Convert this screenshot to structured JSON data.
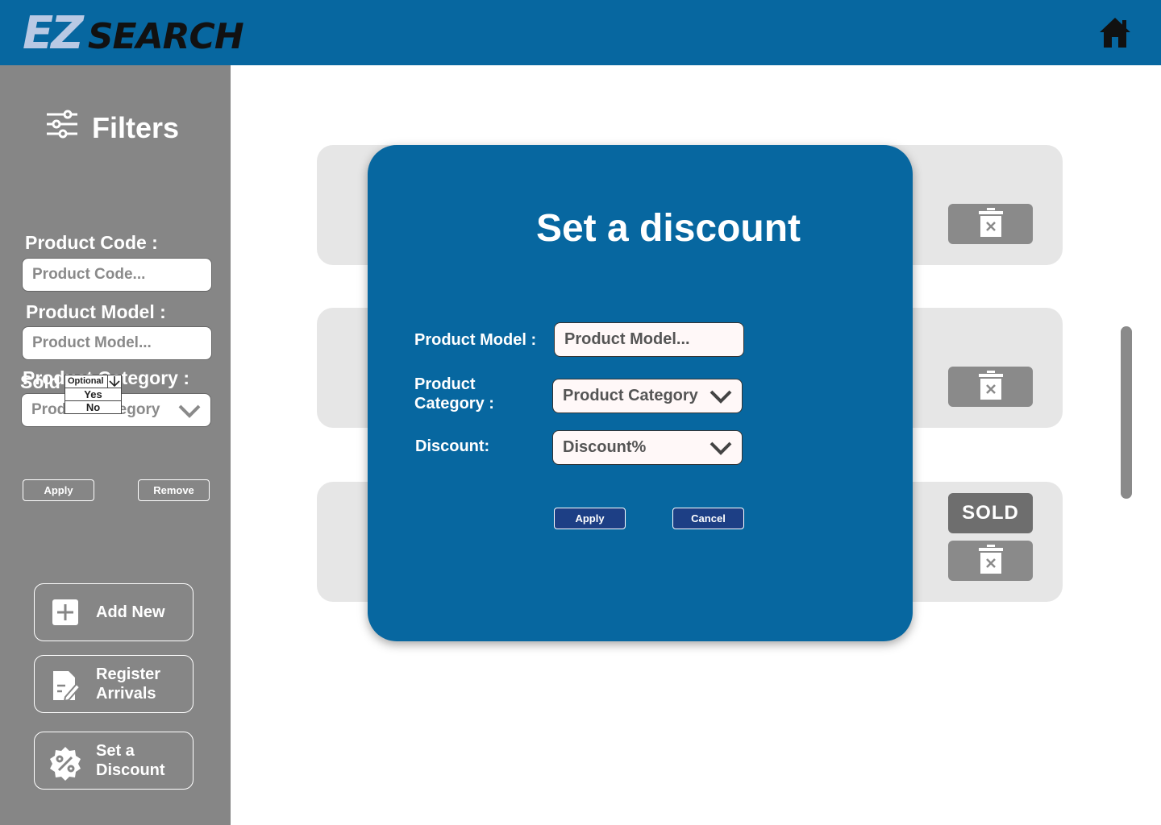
{
  "header": {
    "logo_ez": "EZ",
    "logo_search": "SEARCH",
    "home_icon": "home-icon",
    "bg_color": "#0767a0"
  },
  "sidebar": {
    "filters_title": "Filters",
    "product_code": {
      "label": "Product Code :",
      "placeholder": "Product Code..."
    },
    "product_model": {
      "label": "Product Model :",
      "placeholder": "Product Model..."
    },
    "product_category": {
      "label": "Product Category :",
      "value": "Product Category"
    },
    "sold": {
      "label": "Sold",
      "options": [
        "Optional",
        "Yes",
        "No"
      ]
    },
    "apply_label": "Apply",
    "remove_label": "Remove",
    "actions": [
      {
        "label": "Add New",
        "icon": "plus-icon"
      },
      {
        "label": "Register Arrivals",
        "icon": "edit-document-icon"
      },
      {
        "label": "Set a Discount",
        "icon": "percent-badge-icon"
      }
    ]
  },
  "list": {
    "sold_badge": "SOLD",
    "delete_icon": "trash-icon"
  },
  "modal": {
    "title": "Set a discount",
    "product_model": {
      "label": "Product Model :",
      "placeholder": "Product Model..."
    },
    "product_category": {
      "label_line1": "Product",
      "label_line2": "Category :",
      "value": "Product Category"
    },
    "discount": {
      "label": "Discount:",
      "value": "Discount%"
    },
    "apply_label": "Apply",
    "cancel_label": "Cancel"
  }
}
